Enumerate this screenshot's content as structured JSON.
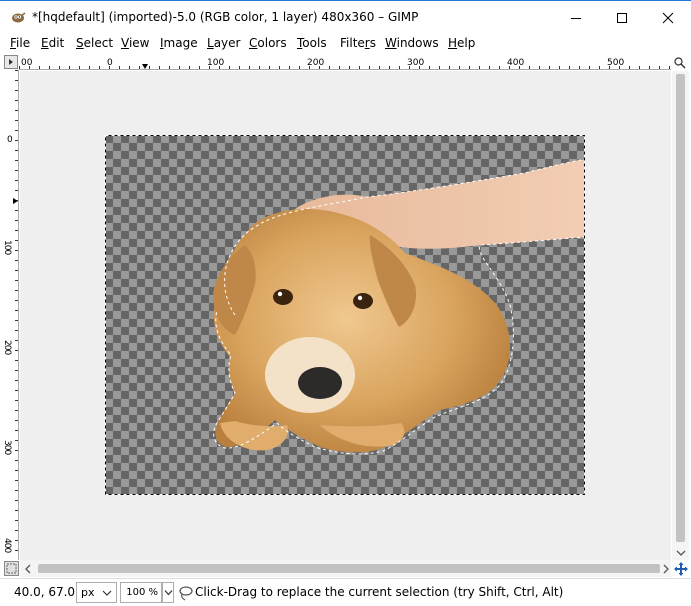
{
  "window": {
    "title": "*[hqdefault] (imported)-5.0 (RGB color, 1 layer) 480x360 – GIMP"
  },
  "menu": {
    "items": [
      {
        "mnemonic": "F",
        "rest": "ile"
      },
      {
        "mnemonic": "E",
        "rest": "dit"
      },
      {
        "mnemonic": "S",
        "rest": "elect"
      },
      {
        "mnemonic": "V",
        "rest": "iew"
      },
      {
        "mnemonic": "I",
        "rest": "mage"
      },
      {
        "mnemonic": "L",
        "rest": "ayer"
      },
      {
        "mnemonic": "C",
        "rest": "olors"
      },
      {
        "mnemonic": "T",
        "rest": "ools"
      },
      {
        "mnemonic": "",
        "pre": "Filte",
        "mn2": "r",
        "rest": "s"
      },
      {
        "mnemonic": "W",
        "rest": "indows"
      },
      {
        "mnemonic": "H",
        "rest": "elp"
      }
    ]
  },
  "rulers": {
    "horizontal_labels": [
      "00",
      "0",
      "100",
      "200",
      "300",
      "400",
      "500"
    ],
    "vertical_labels": [
      "0",
      "100",
      "200",
      "300",
      "400"
    ]
  },
  "status": {
    "coords": "40.0, 67.0",
    "unit": "px",
    "zoom": "100 %",
    "message": "Click-Drag to replace the current selection (try Shift, Ctrl, Alt)"
  },
  "colors": {
    "accent": "#1e7ad7",
    "checker_dark": "#666666",
    "checker_light": "#999999",
    "canvas_bg": "#efefef"
  },
  "icons": {
    "app": "gimp-wilber-icon",
    "minimize": "minimize-icon",
    "maximize": "maximize-icon",
    "close": "close-icon",
    "navigate": "navigate-icon",
    "quick_mask": "quick-mask-icon",
    "zoom_toggle": "zoom-follow-icon",
    "status_tool": "lasso-icon"
  }
}
